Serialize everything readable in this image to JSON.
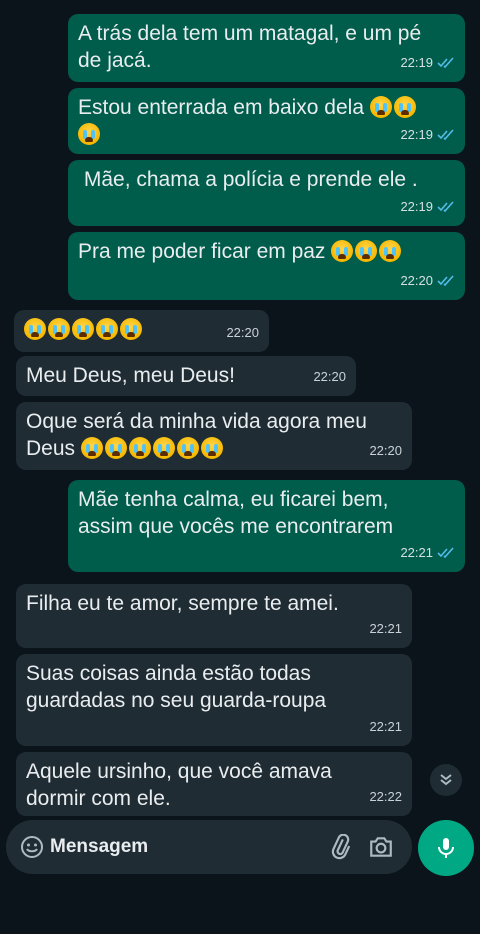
{
  "messages": [
    {
      "type": "out",
      "text": "A trás dela tem um matagal, e um pé\nde jacá.",
      "time": "22:19",
      "emojis": 0
    },
    {
      "type": "out",
      "text": "Estou enterrada em baixo dela",
      "time": "22:19",
      "emojis": 3
    },
    {
      "type": "out",
      "text": " Mãe, chama a polícia e prende ele .",
      "time": "22:19",
      "emojis": 0
    },
    {
      "type": "out",
      "text": "Pra me poder ficar em paz",
      "time": "22:20",
      "emojis": 3
    },
    {
      "type": "in",
      "text": "",
      "time": "22:20",
      "emojis": 5
    },
    {
      "type": "in",
      "text": "Meu Deus, meu Deus!",
      "time": "22:20",
      "emojis": 0
    },
    {
      "type": "in",
      "text": "Oque será da minha vida agora meu\nDeus",
      "time": "22:20",
      "emojis": 6
    },
    {
      "type": "out",
      "text": "Mãe tenha calma, eu ficarei bem,\nassim que vocês me encontrarem",
      "time": "22:21",
      "emojis": 0
    },
    {
      "type": "in",
      "text": "Filha eu te amor, sempre te amei.",
      "time": "22:21",
      "emojis": 0
    },
    {
      "type": "in",
      "text": "Suas coisas ainda estão todas\nguardadas no seu guarda-roupa",
      "time": "22:21",
      "emojis": 0
    },
    {
      "type": "in",
      "text": "Aquele ursinho, que você amava\ndormir com ele.",
      "time": "22:22",
      "emojis": 0
    }
  ],
  "composer": {
    "placeholder": "Mensagem"
  },
  "icons": {
    "emoji": "smile-icon",
    "attach": "paperclip-icon",
    "camera": "camera-icon",
    "mic": "microphone-icon",
    "scroll": "double-chevron-down-icon",
    "read": "double-check-icon"
  },
  "colors": {
    "background": "#0b141a",
    "outgoing": "#005c4b",
    "incoming": "#1f2c34",
    "accent": "#00a884",
    "read_ticks": "#53bdeb"
  }
}
